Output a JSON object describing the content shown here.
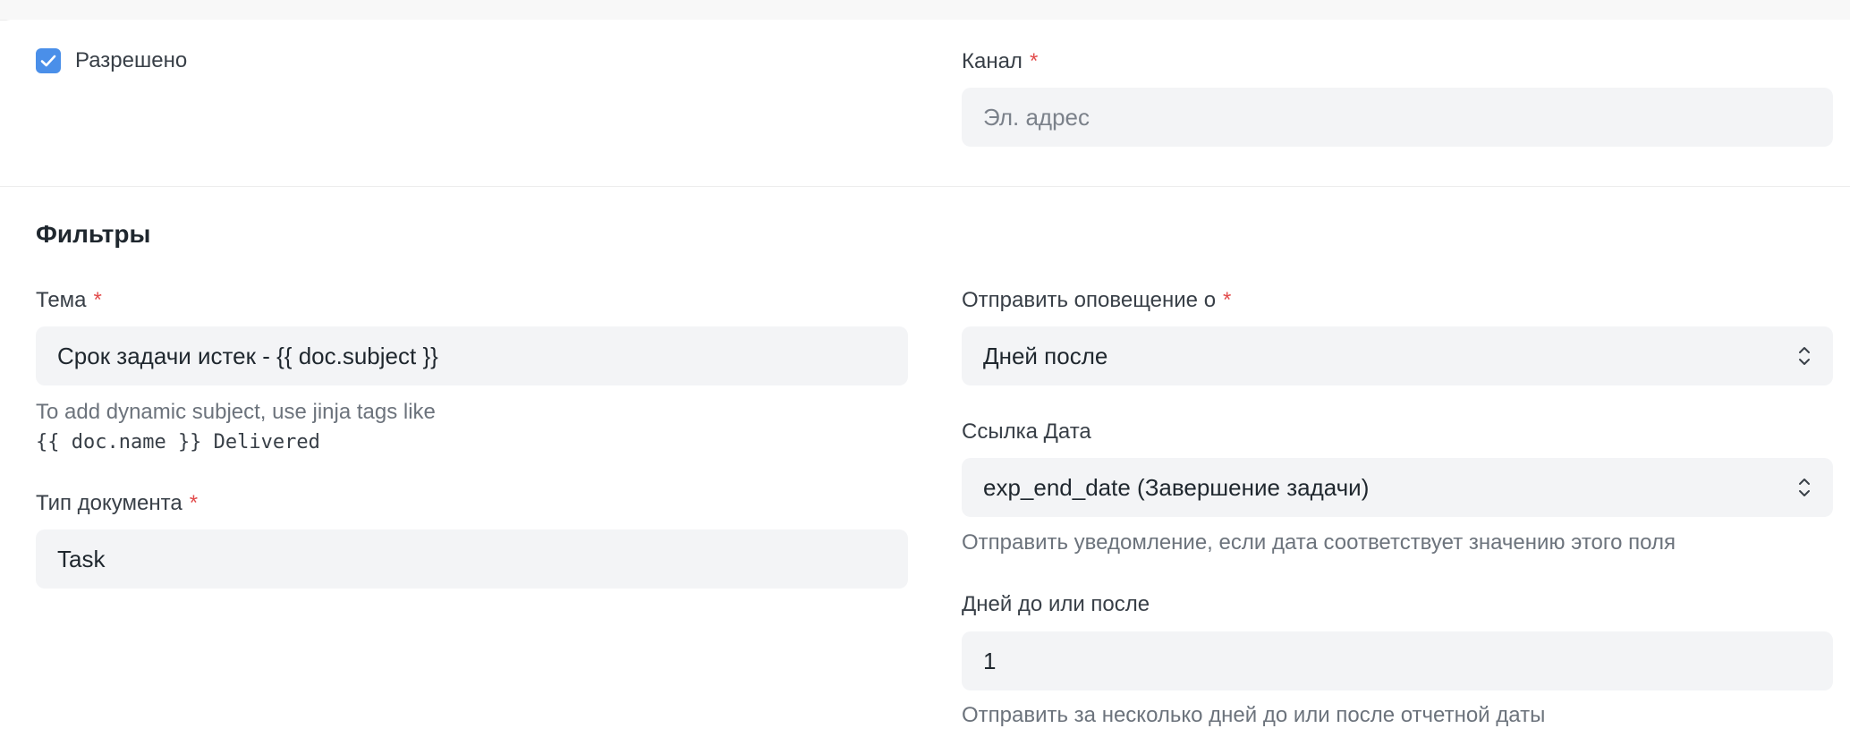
{
  "enabled": {
    "label": "Разрешено",
    "checked": true
  },
  "channel": {
    "label": "Канал",
    "required_mark": "*",
    "value": "Эл. адрес"
  },
  "filters": {
    "title": "Фильтры"
  },
  "subject": {
    "label": "Тема",
    "required_mark": "*",
    "value": "Срок задачи истек - {{ doc.subject }}",
    "help_line1": "To add dynamic subject, use jinja tags like",
    "help_line2": "{{ doc.name }} Delivered"
  },
  "document_type": {
    "label": "Тип документа",
    "required_mark": "*",
    "value": "Task"
  },
  "send_alert_on": {
    "label": "Отправить оповещение о",
    "required_mark": "*",
    "value": "Дней после"
  },
  "reference_date": {
    "label": "Ссылка Дата",
    "value": "exp_end_date (Завершение задачи)",
    "help": "Отправить уведомление, если дата соответствует значению этого поля"
  },
  "days_before_after": {
    "label": "Дней до или после",
    "value": "1",
    "help": "Отправить за несколько дней до или после отчетной даты"
  },
  "colors": {
    "accent": "#4a8fe9",
    "required": "#e24c4c",
    "control_bg": "#f3f4f6"
  },
  "icons": {
    "checkbox": "check-icon",
    "select": "chevron-up-down-icon"
  }
}
